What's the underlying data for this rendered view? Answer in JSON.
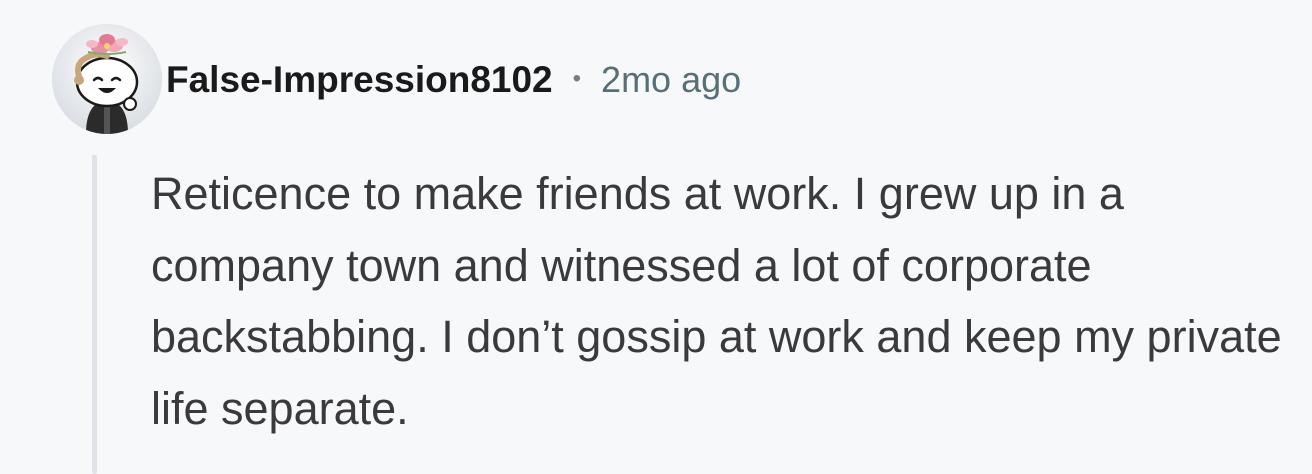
{
  "comment": {
    "avatar_icon": "snoo-avatar-icon",
    "username": "False-Impression8102",
    "separator": "•",
    "time_ago": "2mo ago",
    "body": "Reticence to make friends at work. I grew up in a company town and witnessed a lot of corporate backstabbing. I don’t gossip at work and keep my private life separate."
  },
  "colors": {
    "background": "#f7f8fa",
    "username": "#1a1a1b",
    "timestamp": "#576f76",
    "body_text": "#3a3a3c",
    "thread_line": "#dfe3e8"
  }
}
